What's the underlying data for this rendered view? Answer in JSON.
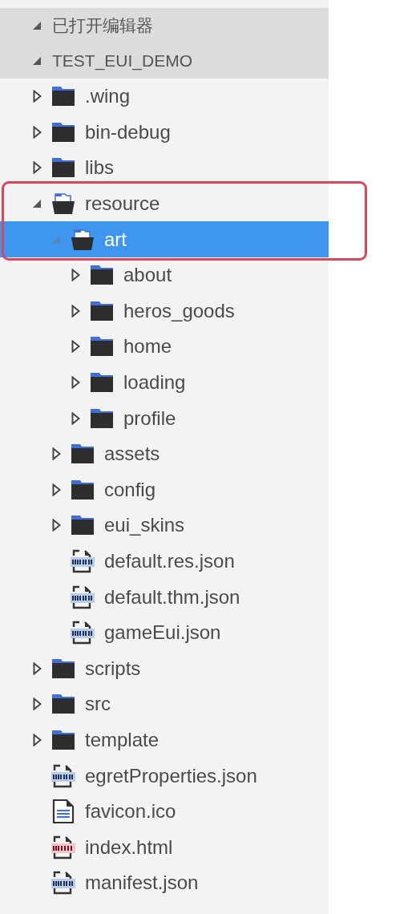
{
  "sections": [
    {
      "label": "已打开编辑器",
      "expanded": true
    },
    {
      "label": "TEST_EUI_DEMO",
      "expanded": true
    }
  ],
  "tree": [
    {
      "name": ".wing",
      "kind": "folder",
      "expanded": false,
      "selected": false,
      "outlined": false
    },
    {
      "name": "bin-debug",
      "kind": "folder",
      "expanded": false,
      "selected": false,
      "outlined": false
    },
    {
      "name": "libs",
      "kind": "folder",
      "expanded": false,
      "selected": false,
      "outlined": false
    },
    {
      "name": "resource",
      "kind": "folder",
      "expanded": true,
      "selected": false,
      "outlined": true,
      "children": [
        {
          "name": "art",
          "kind": "folder",
          "expanded": true,
          "selected": true,
          "outlined": true,
          "children": [
            {
              "name": "about",
              "kind": "folder",
              "expanded": false,
              "selected": false,
              "outlined": false
            },
            {
              "name": "heros_goods",
              "kind": "folder",
              "expanded": false,
              "selected": false,
              "outlined": false
            },
            {
              "name": "home",
              "kind": "folder",
              "expanded": false,
              "selected": false,
              "outlined": false
            },
            {
              "name": "loading",
              "kind": "folder",
              "expanded": false,
              "selected": false,
              "outlined": false
            },
            {
              "name": "profile",
              "kind": "folder",
              "expanded": false,
              "selected": false,
              "outlined": false
            }
          ]
        },
        {
          "name": "assets",
          "kind": "folder",
          "expanded": false,
          "selected": false,
          "outlined": false
        },
        {
          "name": "config",
          "kind": "folder",
          "expanded": false,
          "selected": false,
          "outlined": false
        },
        {
          "name": "eui_skins",
          "kind": "folder",
          "expanded": false,
          "selected": false,
          "outlined": false
        },
        {
          "name": "default.res.json",
          "kind": "json",
          "selected": false,
          "outlined": false
        },
        {
          "name": "default.thm.json",
          "kind": "json",
          "selected": false,
          "outlined": false
        },
        {
          "name": "gameEui.json",
          "kind": "json",
          "selected": false,
          "outlined": false
        }
      ]
    },
    {
      "name": "scripts",
      "kind": "folder",
      "expanded": false,
      "selected": false,
      "outlined": false
    },
    {
      "name": "src",
      "kind": "folder",
      "expanded": false,
      "selected": false,
      "outlined": false
    },
    {
      "name": "template",
      "kind": "folder",
      "expanded": false,
      "selected": false,
      "outlined": false
    },
    {
      "name": "egretProperties.json",
      "kind": "json",
      "selected": false,
      "outlined": false
    },
    {
      "name": "favicon.ico",
      "kind": "text",
      "selected": false,
      "outlined": false
    },
    {
      "name": "index.html",
      "kind": "html",
      "selected": false,
      "outlined": false
    },
    {
      "name": "manifest.json",
      "kind": "json",
      "selected": false,
      "outlined": false
    }
  ]
}
